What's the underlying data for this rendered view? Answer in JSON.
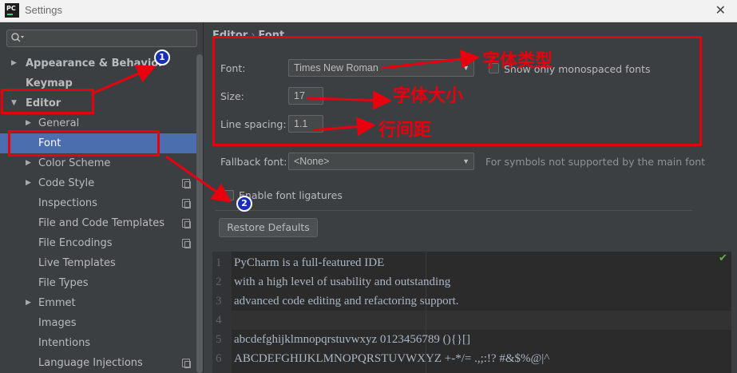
{
  "window": {
    "title": "Settings",
    "logo_text": "PC",
    "close_glyph": "✕"
  },
  "sidebar": {
    "search_placeholder": "",
    "items": [
      {
        "label": "Appearance & Behavior",
        "arrow": "▶",
        "bold": true
      },
      {
        "label": "Keymap",
        "arrow": "",
        "bold": true
      },
      {
        "label": "Editor",
        "arrow": "▼",
        "bold": true
      },
      {
        "label": "General",
        "arrow": "▶"
      },
      {
        "label": "Font",
        "arrow": "",
        "selected": true
      },
      {
        "label": "Color Scheme",
        "arrow": "▶"
      },
      {
        "label": "Code Style",
        "arrow": "▶",
        "copy_icon": true
      },
      {
        "label": "Inspections",
        "copy_icon": true
      },
      {
        "label": "File and Code Templates",
        "copy_icon": true
      },
      {
        "label": "File Encodings",
        "copy_icon": true
      },
      {
        "label": "Live Templates"
      },
      {
        "label": "File Types"
      },
      {
        "label": "Emmet",
        "arrow": "▶"
      },
      {
        "label": "Images"
      },
      {
        "label": "Intentions"
      },
      {
        "label": "Language Injections",
        "copy_icon": true
      }
    ]
  },
  "breadcrumb": {
    "part1": "Editor",
    "sep": "›",
    "part2": "Font"
  },
  "form": {
    "font_label": "Font:",
    "font_value": "Times New Roman",
    "monospaced_label": "Show only monospaced fonts",
    "size_label": "Size:",
    "size_value": "17",
    "line_spacing_label": "Line spacing:",
    "line_spacing_value": "1.1",
    "fallback_label": "Fallback font:",
    "fallback_value": "<None>",
    "fallback_hint": "For symbols not supported by the main font",
    "ligatures_label": "Enable font ligatures",
    "restore_button": "Restore Defaults"
  },
  "preview": {
    "lines": [
      {
        "n": "1",
        "text": "PyCharm is a full-featured IDE"
      },
      {
        "n": "2",
        "text": "with a high level of usability and outstanding"
      },
      {
        "n": "3",
        "text": "advanced code editing and refactoring support."
      },
      {
        "n": "4",
        "text": ""
      },
      {
        "n": "5",
        "text": "abcdefghijklmnopqrstuvwxyz 0123456789 (){}[]"
      },
      {
        "n": "6",
        "text": "ABCDEFGHIJKLMNOPQRSTUVWXYZ +-*/= .,;:!? #&$%@|^"
      }
    ],
    "check_glyph": "✔"
  },
  "annotations": {
    "font_type": "字体类型",
    "font_size": "字体大小",
    "line_spacing": "行间距",
    "badge1": "1",
    "badge2": "2",
    "color": "#e8000f",
    "badge_color": "#1a2fb8"
  },
  "colors": {
    "selected": "#4b6eaf",
    "background": "#3c3f41",
    "editor_bg": "#2b2b2b"
  }
}
